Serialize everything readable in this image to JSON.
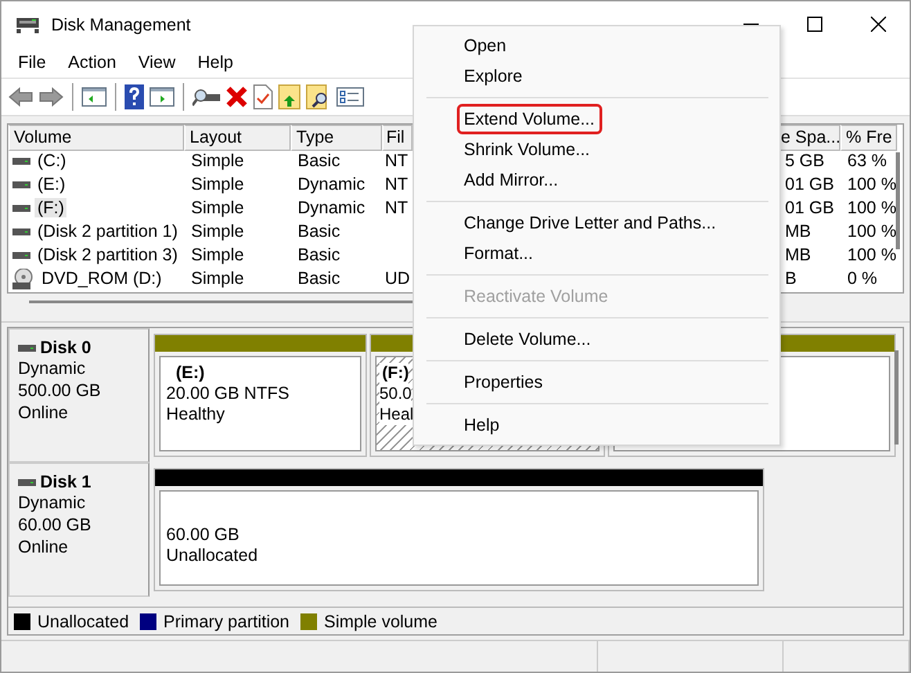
{
  "window": {
    "title": "Disk Management"
  },
  "menu_bar": [
    "File",
    "Action",
    "View",
    "Help"
  ],
  "volume_list": {
    "columns": [
      "Volume",
      "Layout",
      "Type",
      "Fil",
      "e Spa...",
      "% Fre"
    ],
    "rows": [
      {
        "kind": "drive",
        "selected": false,
        "cells": [
          "(C:)",
          "Simple",
          "Basic",
          "NT",
          "5 GB",
          "63 %"
        ]
      },
      {
        "kind": "drive",
        "selected": false,
        "cells": [
          "(E:)",
          "Simple",
          "Dynamic",
          "NT",
          "01 GB",
          "100 %"
        ]
      },
      {
        "kind": "drive",
        "selected": true,
        "cells": [
          "(F:)",
          "Simple",
          "Dynamic",
          "NT",
          "01 GB",
          "100 %"
        ]
      },
      {
        "kind": "drive",
        "selected": false,
        "cells": [
          "(Disk 2 partition 1)",
          "Simple",
          "Basic",
          "",
          "MB",
          "100 %"
        ]
      },
      {
        "kind": "drive",
        "selected": false,
        "cells": [
          "(Disk 2 partition 3)",
          "Simple",
          "Basic",
          "",
          "MB",
          "100 %"
        ]
      },
      {
        "kind": "disc",
        "selected": false,
        "cells": [
          "DVD_ROM (D:)",
          "Simple",
          "Basic",
          "UD",
          "B",
          "0 %"
        ]
      }
    ]
  },
  "disks": [
    {
      "name": "Disk 0",
      "lines": [
        "Dynamic",
        "500.00 GB",
        "Online"
      ],
      "partitions": [
        {
          "color": "#808000",
          "selected": false,
          "title": "(E:)",
          "lines": [
            "20.00 GB NTFS",
            "Healthy"
          ]
        },
        {
          "color": "#808000",
          "selected": true,
          "title": "(F:)",
          "lines": [
            "50.0",
            "Heal"
          ]
        },
        {
          "color": "#808000",
          "selected": false
        }
      ]
    },
    {
      "name": "Disk 1",
      "lines": [
        "Dynamic",
        "60.00 GB",
        "Online"
      ],
      "partitions": [
        {
          "color": "#000000",
          "selected": false,
          "lines": [
            "60.00 GB",
            "Unallocated"
          ]
        }
      ]
    }
  ],
  "legend": [
    {
      "label": "Unallocated",
      "color": "#000000"
    },
    {
      "label": "Primary partition",
      "color": "#000080"
    },
    {
      "label": "Simple volume",
      "color": "#808000"
    }
  ],
  "context_menu": [
    {
      "kind": "item",
      "label": "Open",
      "disabled": false,
      "selected": false
    },
    {
      "kind": "item",
      "label": "Explore",
      "disabled": false,
      "selected": false
    },
    {
      "kind": "separator"
    },
    {
      "kind": "item",
      "label": "Extend Volume...",
      "disabled": false,
      "selected": true
    },
    {
      "kind": "item",
      "label": "Shrink Volume...",
      "disabled": false,
      "selected": false
    },
    {
      "kind": "item",
      "label": "Add Mirror...",
      "disabled": false,
      "selected": false
    },
    {
      "kind": "separator"
    },
    {
      "kind": "item",
      "label": "Change Drive Letter and Paths...",
      "disabled": false,
      "selected": false
    },
    {
      "kind": "item",
      "label": "Format...",
      "disabled": false,
      "selected": false
    },
    {
      "kind": "separator"
    },
    {
      "kind": "item",
      "label": "Reactivate Volume",
      "disabled": true,
      "selected": false
    },
    {
      "kind": "separator"
    },
    {
      "kind": "item",
      "label": "Delete Volume...",
      "disabled": false,
      "selected": false
    },
    {
      "kind": "separator"
    },
    {
      "kind": "item",
      "label": "Properties",
      "disabled": false,
      "selected": false
    },
    {
      "kind": "separator"
    },
    {
      "kind": "item",
      "label": "Help",
      "disabled": false,
      "selected": false
    }
  ]
}
